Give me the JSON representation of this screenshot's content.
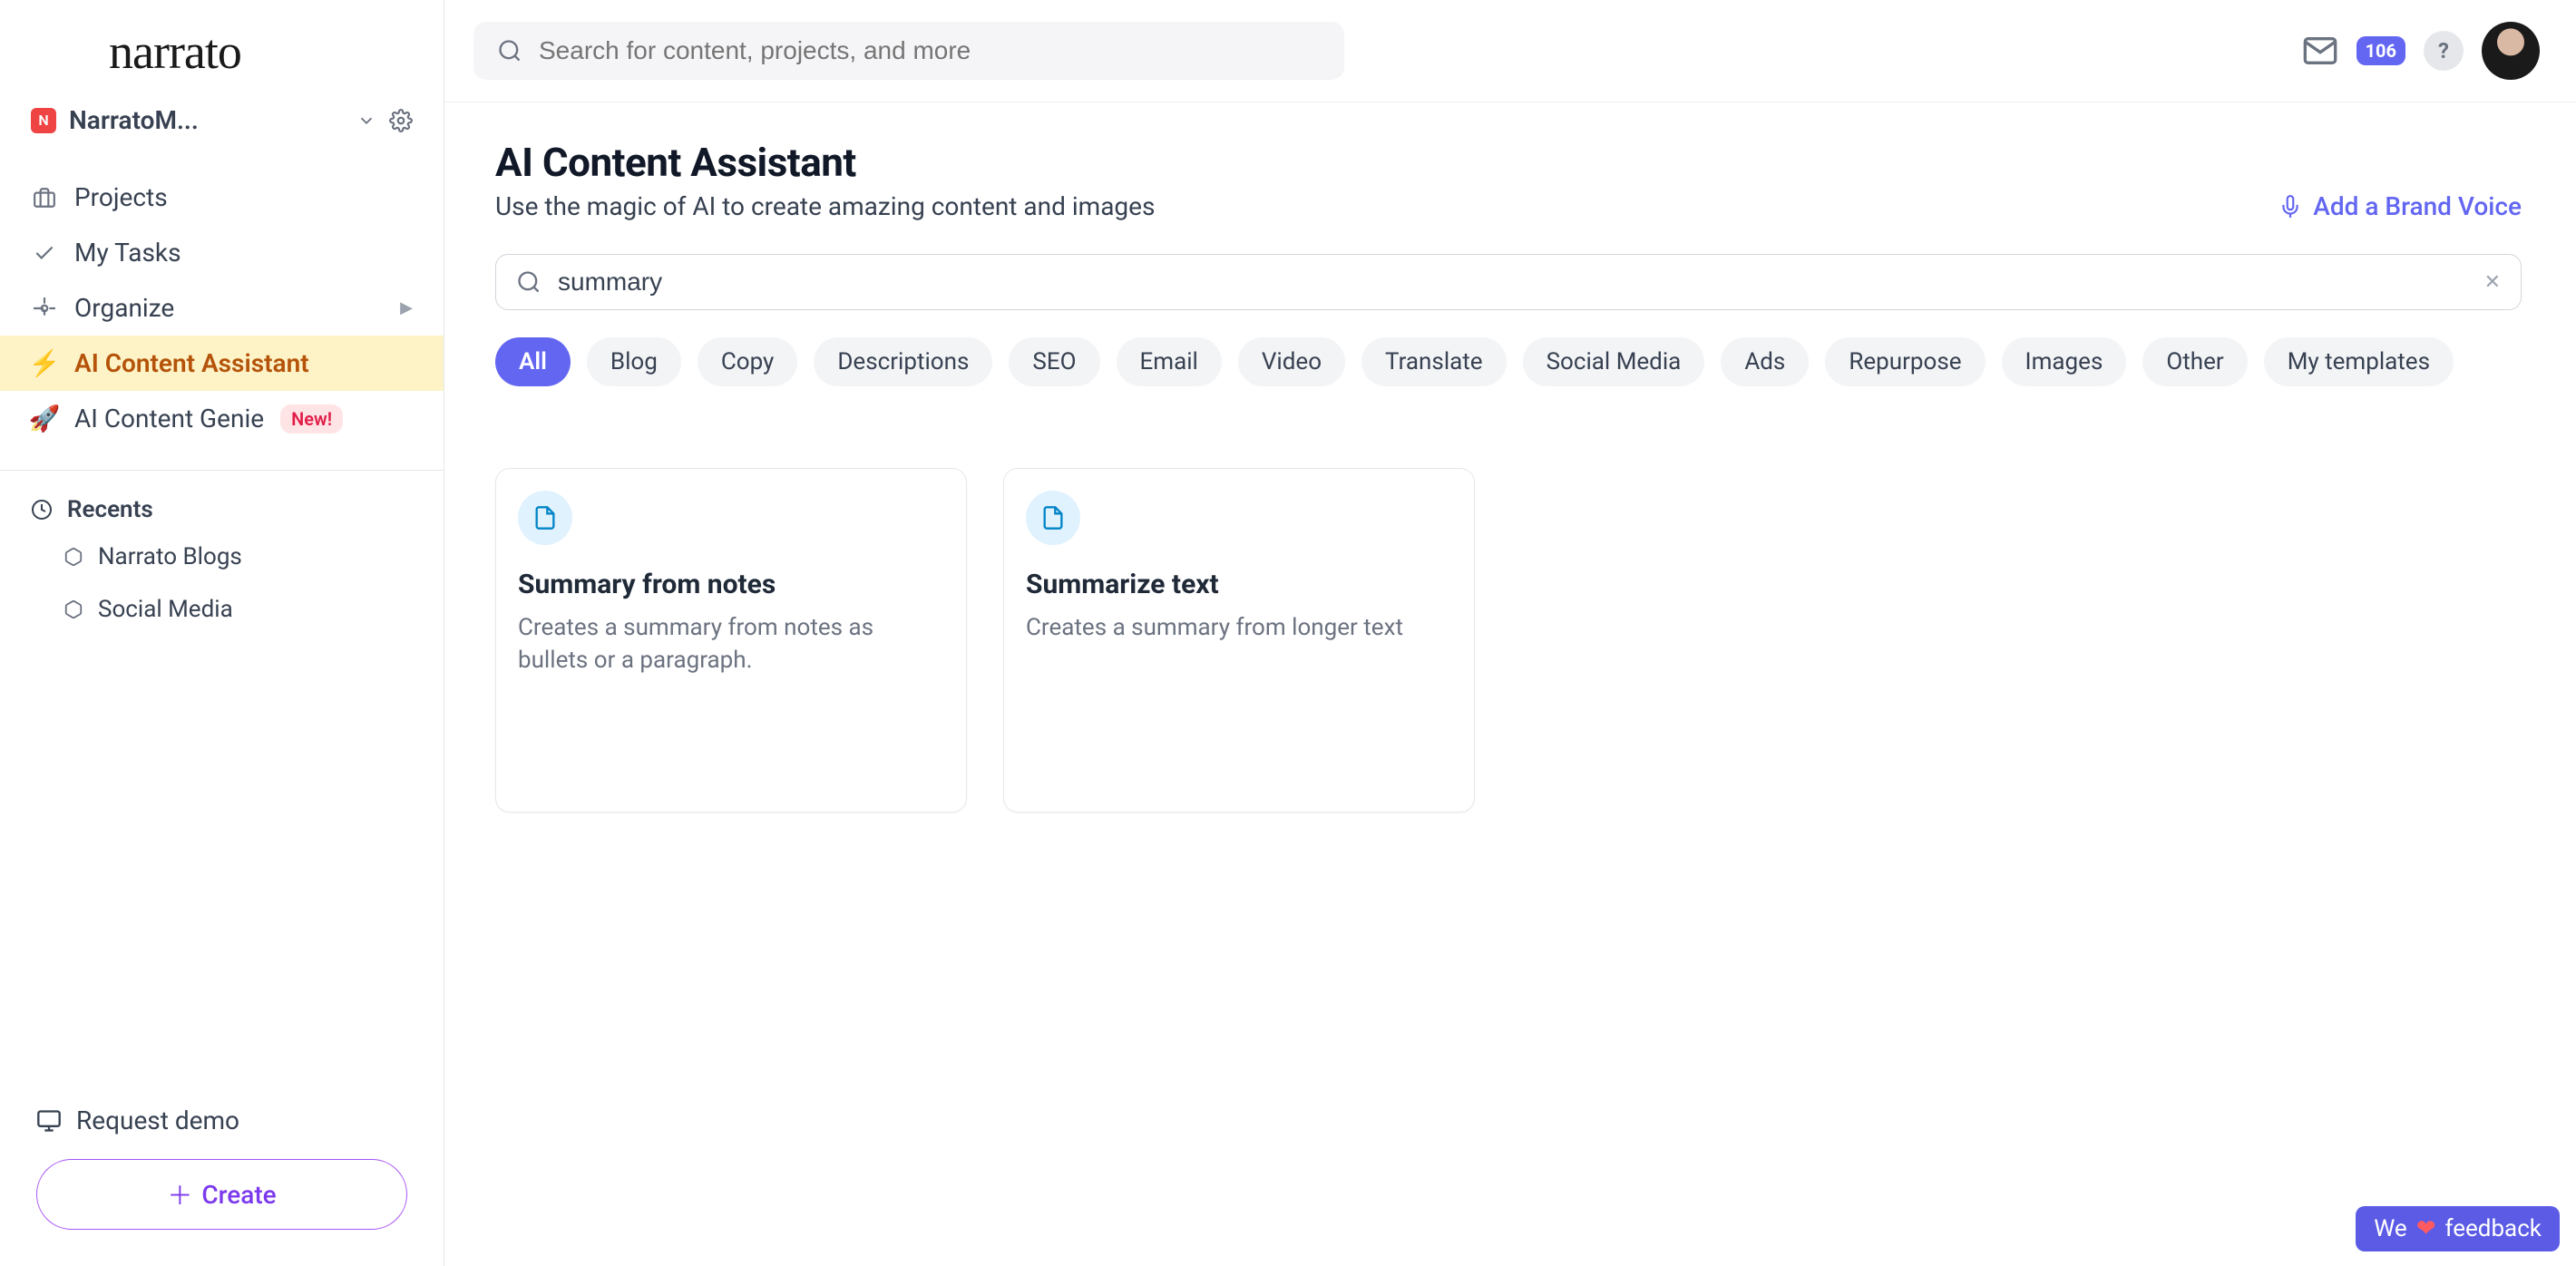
{
  "brand": "narrato",
  "workspace": {
    "initial": "N",
    "name": "NarratoM..."
  },
  "sidebar": {
    "projects": "Projects",
    "mytasks": "My Tasks",
    "organize": "Organize",
    "assistant": "AI Content Assistant",
    "genie": "AI Content Genie",
    "genie_badge": "New!",
    "recents_header": "Recents",
    "recents": [
      "Narrato Blogs",
      "Social Media"
    ],
    "request_demo": "Request demo",
    "create": "Create"
  },
  "topbar": {
    "search_placeholder": "Search for content, projects, and more",
    "notif_count": "106"
  },
  "page": {
    "title": "AI Content Assistant",
    "subtitle": "Use the magic of AI to create amazing content and images",
    "brand_voice": "Add a Brand Voice"
  },
  "template_search": {
    "value": "summary"
  },
  "chips": [
    "All",
    "Blog",
    "Copy",
    "Descriptions",
    "SEO",
    "Email",
    "Video",
    "Translate",
    "Social Media",
    "Ads",
    "Repurpose",
    "Images",
    "Other",
    "My templates"
  ],
  "active_chip": 0,
  "cards": [
    {
      "title": "Summary from notes",
      "desc": "Creates a summary from notes as bullets or a paragraph."
    },
    {
      "title": "Summarize text",
      "desc": "Creates a summary from longer text"
    }
  ],
  "feedback": {
    "pre": "We",
    "post": "feedback"
  }
}
